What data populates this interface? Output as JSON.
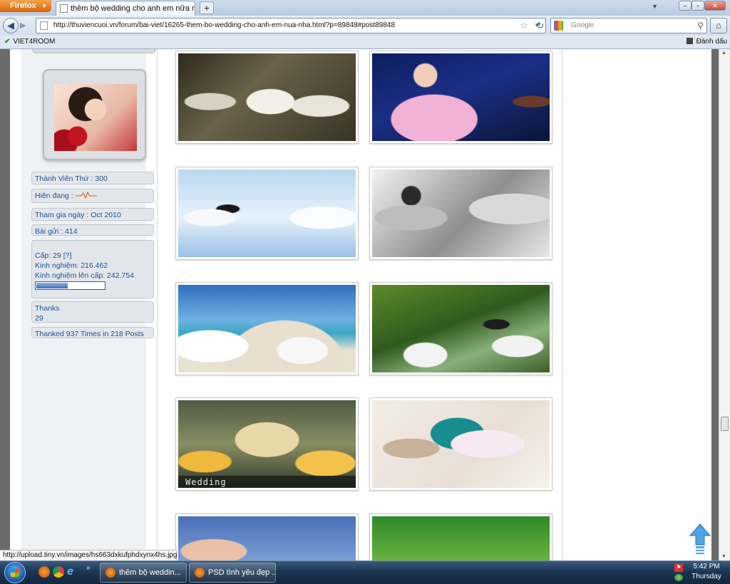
{
  "browser": {
    "app_button": "Firefox",
    "tab_title": "thêm bộ wedding cho anh em nữa nha",
    "new_tab": "+",
    "url": "http://thuviencuoi.vn/forum/bai-viet/16265-them-bo-wedding-cho-anh-em-nua-nha.html?p=89848#post89848",
    "search_placeholder": "Google",
    "bookmarks": {
      "left": "VIET4ROOM",
      "right": "Đánh dấu"
    }
  },
  "profile": {
    "member_number": "Thành Viên Thứ : 300",
    "status_label": "Hiện đang :",
    "join_date": "Tham gia ngày : Oct 2010",
    "posts": "Bài gửi : 414",
    "level": "Cấp: 29 [?]",
    "experience": "Kinh nghiệm: 216.462",
    "next_level_exp": "Kinh nghiệm lên cấp: 242.754",
    "progress_fraction": 0.45,
    "thanks_label": "Thanks",
    "thanks_count": "29",
    "thanked": "Thanked 937 Times in 218 Posts"
  },
  "gallery": {
    "p7_caption": "Wedding"
  },
  "status_bar": "http://upload.tiny.vn/images/hs663dxkufphdxynx4hs.jpg",
  "taskbar": {
    "window1": "thêm bộ weddin...",
    "window2": "PSD tình yêu đẹp ...",
    "time": "5:42 PM",
    "day": "Thursday"
  }
}
